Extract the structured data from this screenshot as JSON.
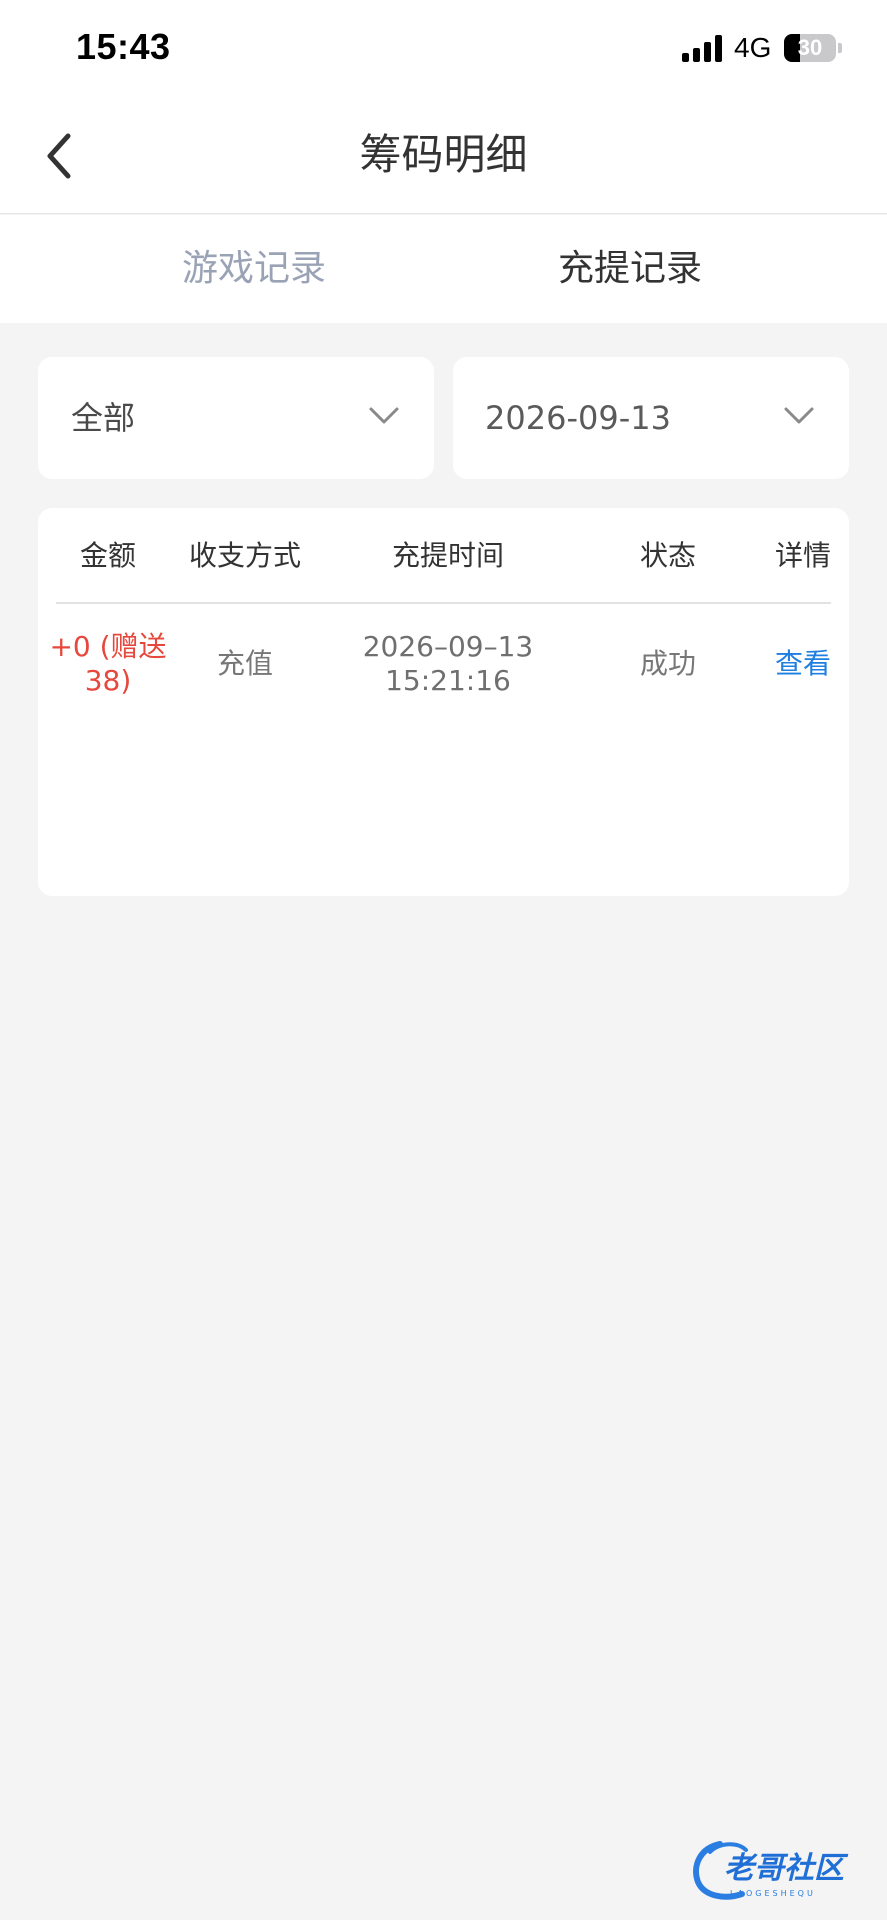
{
  "status_bar": {
    "time": "15:43",
    "network": "4G",
    "battery": "30",
    "battery_level_percent": 30
  },
  "nav": {
    "title": "筹码明细",
    "back_icon": "chevron-left-icon"
  },
  "tabs": [
    {
      "label": "游戏记录",
      "active": false
    },
    {
      "label": "充提记录",
      "active": true
    }
  ],
  "filters": {
    "type_value": "全部",
    "date_value": "2026-09-13",
    "dropdown_icon": "chevron-down-icon"
  },
  "table": {
    "headers": [
      "金额",
      "收支方式",
      "充提时间",
      "状态",
      "详情"
    ],
    "rows": [
      {
        "amount_line1": "+0 (赠送",
        "amount_line2": "38)",
        "method": "充值",
        "date": "2026–09–13",
        "time": "15:21:16",
        "status": "成功",
        "detail": "查看"
      }
    ]
  },
  "watermark": {
    "text": "老哥社区",
    "subtext": "LAOGESHEQU"
  },
  "colors": {
    "amount": "#e6483d",
    "link": "#1f7fe0",
    "tab_inactive": "#9aa3b6",
    "background": "#f4f4f5"
  }
}
